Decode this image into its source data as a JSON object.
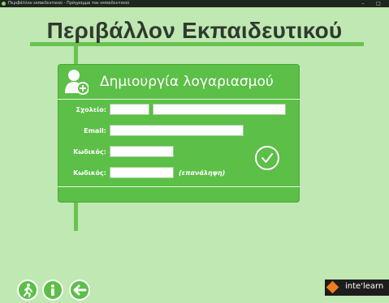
{
  "window": {
    "caption": "Περιβάλλον εκπαιδευτικού - Πρόγραμμα του εκπαιδευτικού",
    "minimize_symbol": "–",
    "maximize_symbol": "□"
  },
  "page": {
    "title": "Περιβάλλον Εκπαιδευτικού"
  },
  "dialog": {
    "title": "Δημιουργία λογαριασμού",
    "fields": {
      "school_label": "Σχολείο:",
      "school_code_value": "",
      "school_name_value": "",
      "email_label": "Email:",
      "email_value": "",
      "password_label": "Κωδικός:",
      "password_value": "",
      "password_confirm_label": "Κωδικός:",
      "password_confirm_value": "",
      "password_confirm_hint": "(επανάληψη)"
    },
    "confirm_icon": "checkmark-icon"
  },
  "footer": {
    "buttons": [
      "exit-icon",
      "info-icon",
      "back-arrow-icon"
    ],
    "logo_text": "inte'learn"
  },
  "colors": {
    "background": "#bfe8b2",
    "accent_green": "#5cbf47",
    "line_green": "#6ac350",
    "title_text": "#303a30"
  }
}
